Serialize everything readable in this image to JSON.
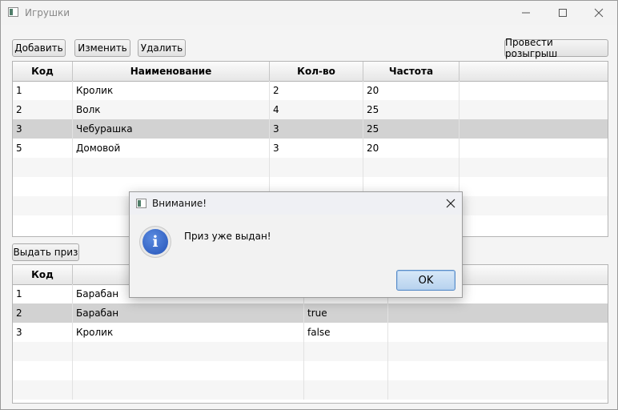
{
  "window": {
    "title": "Игрушки"
  },
  "toolbar": {
    "add_label": "Добавить",
    "edit_label": "Изменить",
    "delete_label": "Удалить",
    "raffle_label": "Провести розыгрыш"
  },
  "toys_table": {
    "columns": [
      "Код",
      "Наименование",
      "Кол-во",
      "Частота"
    ],
    "rows": [
      [
        "1",
        "Кролик",
        "2",
        "20"
      ],
      [
        "2",
        "Волк",
        "4",
        "25"
      ],
      [
        "3",
        "Чебурашка",
        "3",
        "25"
      ],
      [
        "5",
        "Домовой",
        "3",
        "20"
      ]
    ],
    "selected_row": 3
  },
  "prize_button_label": "Выдать приз",
  "prizes_table": {
    "columns": [
      "Код"
    ],
    "rows": [
      [
        "1",
        "Барабан",
        ""
      ],
      [
        "2",
        "Барабан",
        "true"
      ],
      [
        "3",
        "Кролик",
        "false"
      ]
    ],
    "selected_row": 2
  },
  "dialog": {
    "title": "Внимание!",
    "message": "Приз уже выдан!",
    "ok_label": "OK",
    "icon": "info-icon"
  }
}
